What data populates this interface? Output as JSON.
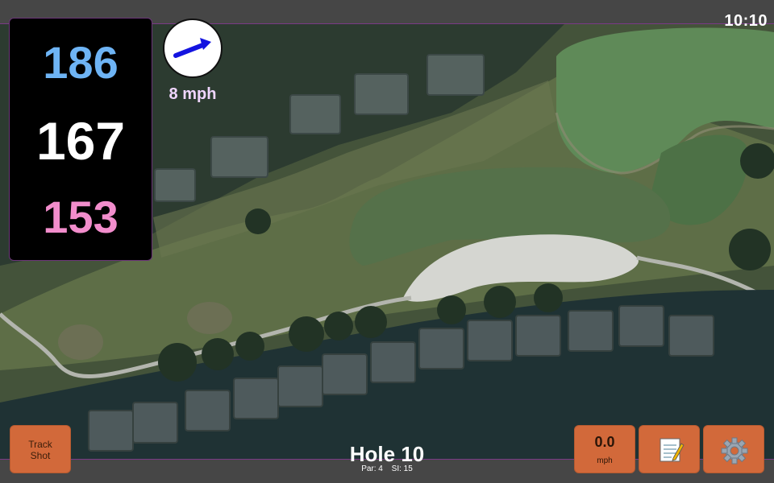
{
  "status": {
    "clock": "10:10"
  },
  "yardages": {
    "back": "186",
    "middle": "167",
    "front": "153"
  },
  "wind": {
    "speed": "8 mph",
    "icon": "wind-arrow-icon"
  },
  "hole": {
    "title": "Hole 10",
    "par_label": "Par: 4",
    "si_label": "SI: 15"
  },
  "buttons": {
    "track_shot_line1": "Track",
    "track_shot_line2": "Shot",
    "speed_value": "0.0",
    "speed_unit": "mph",
    "notes_icon": "notepad-icon",
    "settings_icon": "gear-icon"
  },
  "colors": {
    "back": "#6eb4f5",
    "middle": "#ffffff",
    "front": "#f28dcc",
    "button": "#d2693a",
    "accent_border": "#7a3a86"
  }
}
